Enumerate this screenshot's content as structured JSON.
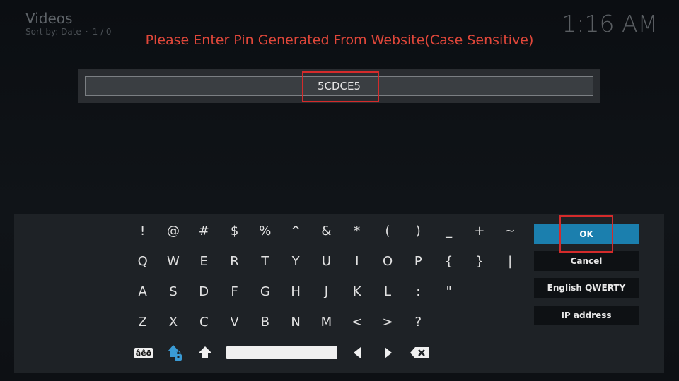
{
  "background": {
    "title": "Videos",
    "sort_label": "Sort by: Date",
    "separator": "·",
    "count": "1 / 0",
    "clock": "1:16 AM"
  },
  "dialog": {
    "heading": "Please Enter Pin Generated From Website(Case Sensitive)",
    "input_value": "5CDCE5"
  },
  "keyboard": {
    "rows": [
      [
        "!",
        "@",
        "#",
        "$",
        "%",
        "^",
        "&",
        "*",
        "(",
        ")",
        "_",
        "+",
        "~"
      ],
      [
        "Q",
        "W",
        "E",
        "R",
        "T",
        "Y",
        "U",
        "I",
        "O",
        "P",
        "{",
        "}",
        "|"
      ],
      [
        "A",
        "S",
        "D",
        "F",
        "G",
        "H",
        "J",
        "K",
        "L",
        ":",
        "\""
      ],
      [
        "Z",
        "X",
        "C",
        "V",
        "B",
        "N",
        "M",
        "<",
        ">",
        "?"
      ]
    ],
    "symbols_label": "âêö",
    "buttons": {
      "ok": "OK",
      "cancel": "Cancel",
      "layout": "English QWERTY",
      "ip": "IP address"
    }
  },
  "colors": {
    "heading": "#e0473a",
    "accent": "#1b7fae",
    "highlight_box": "#d42b2b"
  }
}
